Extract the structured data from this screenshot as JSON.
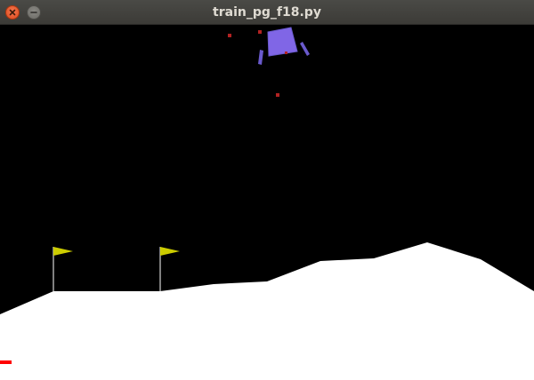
{
  "window": {
    "title": "train_pg_f18.py"
  },
  "icons": {
    "close": "close-icon",
    "minimize": "minimize-icon"
  },
  "colors": {
    "background": "#000000",
    "terrain": "#ffffff",
    "lander_body": "#8066e6",
    "lander_legs": "#6a5acd",
    "flags": "#cccc00",
    "particles": "#b22222",
    "power_bar": "#ff0000"
  }
}
